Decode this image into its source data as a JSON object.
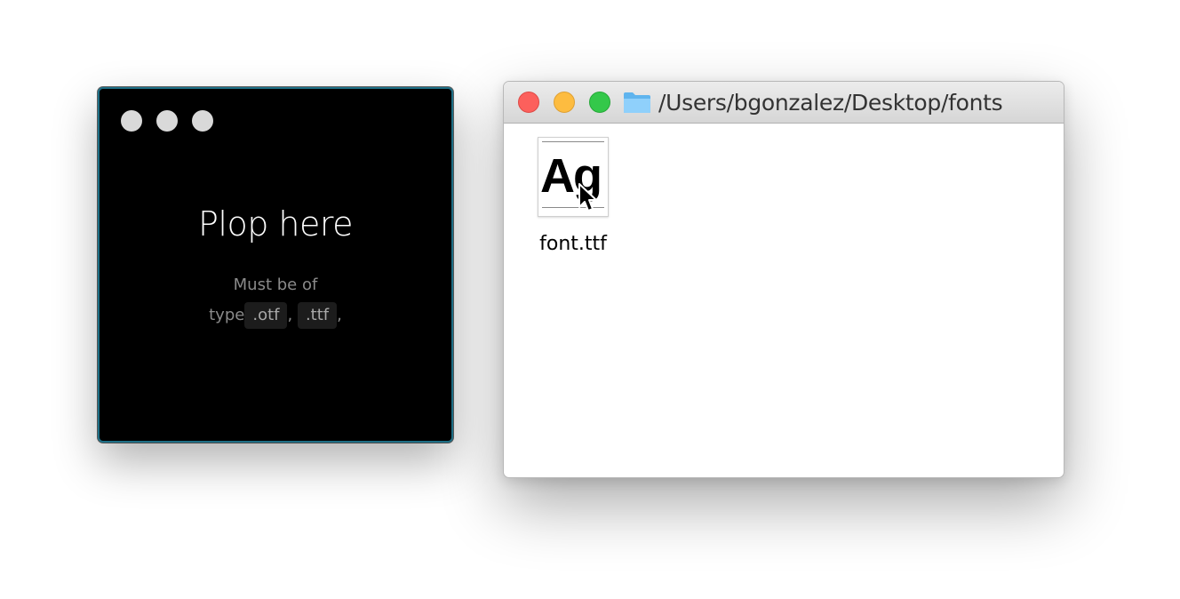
{
  "drop_window": {
    "title": "Plop here",
    "subtitle_line1": "Must be of",
    "subtitle_type_word": "type",
    "extensions": [
      ".otf",
      ".ttf"
    ],
    "separator": ",",
    "trailing": ",",
    "window_dots": [
      "dot",
      "dot",
      "dot"
    ]
  },
  "finder_window": {
    "path": "/Users/bgonzalez/Desktop/fonts",
    "folder_icon": "folder-icon",
    "traffic_lights": {
      "close_color": "#fc605c",
      "minimize_color": "#fdbc40",
      "zoom_color": "#34c84a"
    },
    "files": [
      {
        "name": "font.ttf",
        "preview_text": "Ag",
        "icon": "font-file-icon"
      }
    ]
  },
  "colors": {
    "drop_background": "#000000",
    "drop_border": "#1d6f86",
    "finder_background": "#ffffff"
  },
  "cursor": "arrow-cursor-icon"
}
